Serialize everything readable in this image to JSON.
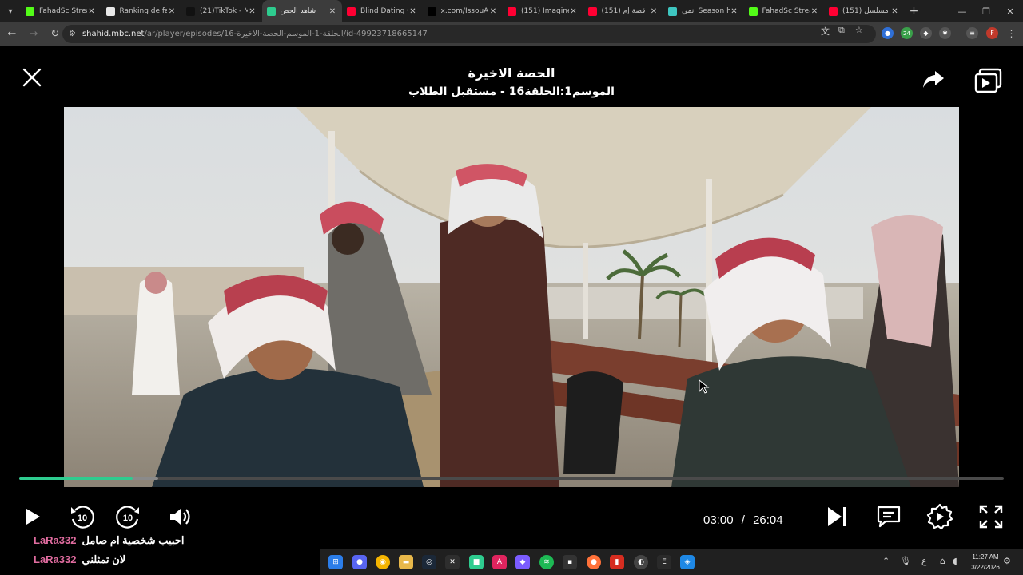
{
  "browser": {
    "tabs": [
      {
        "label": "FahadSc Stream",
        "favicon": "kick-icon",
        "color": "#53fc18",
        "active": false
      },
      {
        "label": "Ranking de fab",
        "favicon": "diamond-icon",
        "color": "#e8e8e8",
        "active": false
      },
      {
        "label": "(21)TikTok - Ma",
        "favicon": "tiktok-icon",
        "color": "#111111",
        "active": false
      },
      {
        "label": "شاهد الحص",
        "favicon": "shahid-icon",
        "color": "#2ecc8f",
        "active": true
      },
      {
        "label": "Blind Dating G",
        "favicon": "youtube-icon",
        "color": "#ff0033",
        "active": false
      },
      {
        "label": "x.com/IssouAb",
        "favicon": "x-icon",
        "color": "#000000",
        "active": false
      },
      {
        "label": "(151) Imagine",
        "favicon": "youtube-icon",
        "color": "#ff0033",
        "active": false
      },
      {
        "label": "(151) قصة إم",
        "favicon": "youtube-icon",
        "color": "#ff0033",
        "active": false
      },
      {
        "label": "انمي Season h",
        "favicon": "anime-icon",
        "color": "#3ec6c0",
        "active": false
      },
      {
        "label": "FahadSc Stream",
        "favicon": "kick-icon",
        "color": "#53fc18",
        "active": false
      },
      {
        "label": "(151) مسلسل",
        "favicon": "youtube-icon",
        "color": "#ff0033",
        "active": false
      }
    ],
    "url_host": "shahid.mbc.net",
    "url_path": "/ar/player/episodes/16-الحلقة-1-الموسم-الحصة-الاخيرة/id-49923718665147"
  },
  "player": {
    "title": "الحصة الاخيرة",
    "subtitle": "الموسم1:الحلقة16 - مستقبل الطلاب",
    "current_time": "03:00",
    "time_separator": "/",
    "duration": "26:04",
    "played_fraction": 0.115,
    "buffered_fraction": 0.141,
    "skip_seconds": "10"
  },
  "chat": [
    {
      "user": "LaRa332",
      "message": "احبيب شخصية ام صامل"
    },
    {
      "user": "LaRa332",
      "message": "لان تمثلني"
    }
  ],
  "taskbar": {
    "time": "11:27 AM",
    "date": "3/22/2026",
    "lang": "ع",
    "ext_badge": "24",
    "profile_letter": "F"
  }
}
